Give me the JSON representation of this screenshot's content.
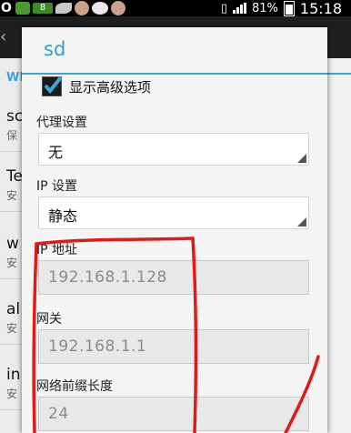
{
  "status_bar": {
    "left_badge": "8",
    "battery_percent": "81%",
    "time": "15:18"
  },
  "background_app": {
    "section_label": "WI",
    "rows": [
      {
        "title": "sc",
        "sub": "保"
      },
      {
        "title": "Te",
        "sub": "安"
      },
      {
        "title": "w",
        "sub": "安"
      },
      {
        "title": "al",
        "sub": "安"
      },
      {
        "title": "in",
        "sub": "安"
      }
    ]
  },
  "dialog": {
    "title": "sd",
    "advanced_checkbox": {
      "label": "显示高级选项",
      "checked": true
    },
    "proxy": {
      "label": "代理设置",
      "value": "无"
    },
    "ip_settings": {
      "label": "IP 设置",
      "value": "静态"
    },
    "ip_address": {
      "label": "IP 地址",
      "value": "192.168.1.128"
    },
    "gateway": {
      "label": "网关",
      "value": "192.168.1.1"
    },
    "prefix_length": {
      "label": "网络前缀长度",
      "value": "24"
    }
  },
  "colors": {
    "accent": "#2d9fd2",
    "annotation": "#e01a1a"
  }
}
